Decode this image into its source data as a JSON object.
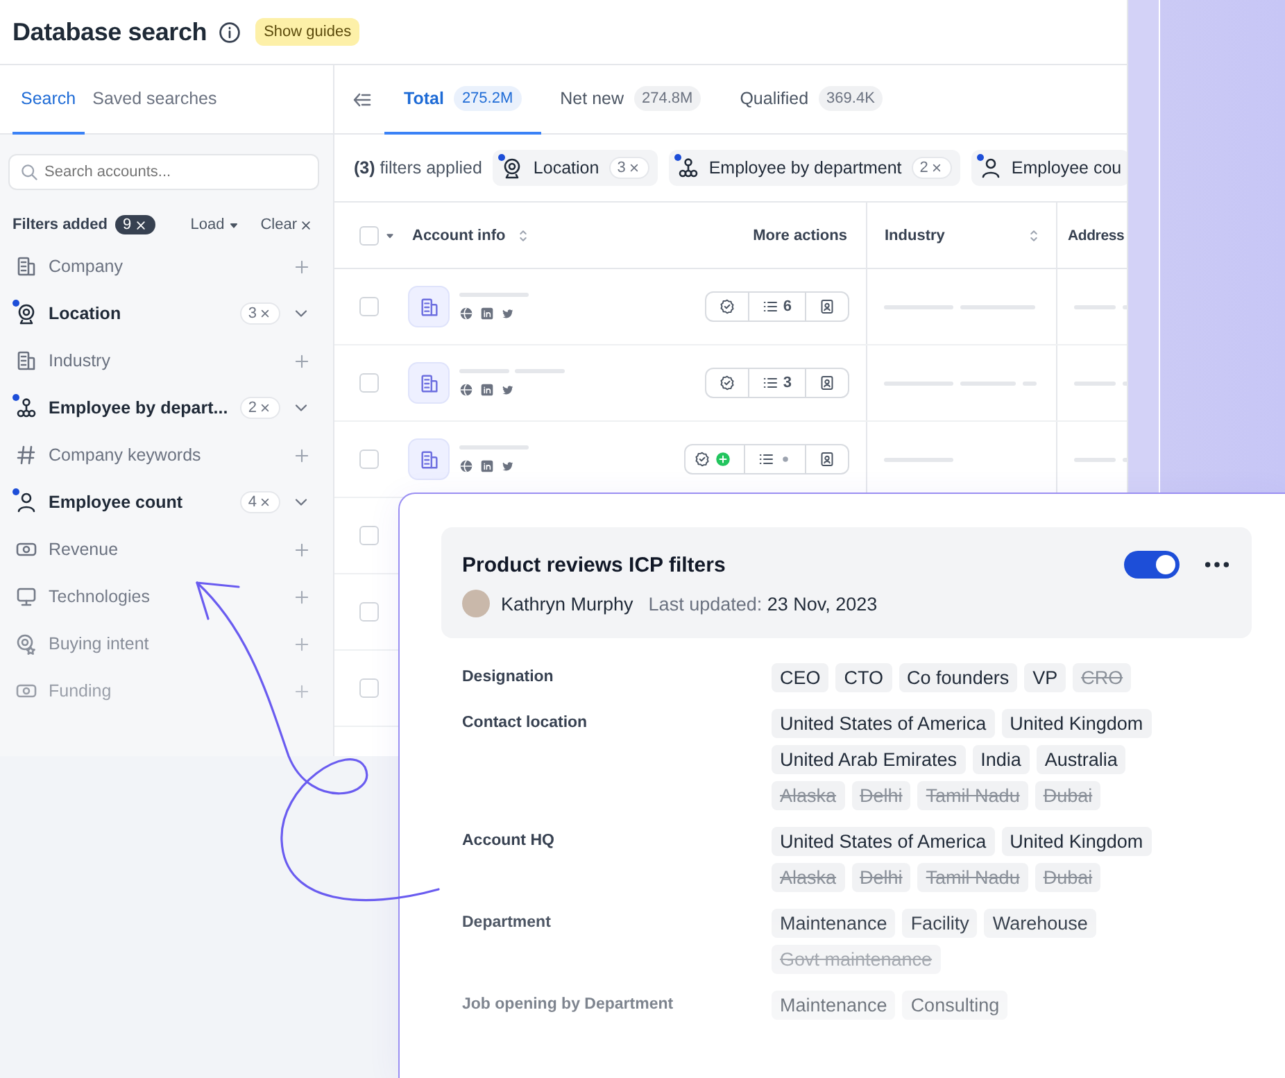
{
  "header": {
    "title": "Database search",
    "guides_button": "Show guides"
  },
  "sidebar": {
    "tabs": [
      {
        "label": "Search",
        "selected": true
      },
      {
        "label": "Saved searches",
        "selected": false
      }
    ],
    "search": {
      "placeholder": "Search accounts..."
    },
    "filters_added": {
      "label": "Filters added",
      "count": "9"
    },
    "load": "Load",
    "clear": "Clear",
    "filters": [
      {
        "label": "Company",
        "kind": "building",
        "active": false
      },
      {
        "label": "Location",
        "kind": "location",
        "active": true,
        "count": "3"
      },
      {
        "label": "Industry",
        "kind": "building",
        "active": false
      },
      {
        "label": "Employee by depart...",
        "kind": "department",
        "active": true,
        "count": "2"
      },
      {
        "label": "Company keywords",
        "kind": "hash",
        "active": false
      },
      {
        "label": "Employee count",
        "kind": "person",
        "active": true,
        "count": "4"
      },
      {
        "label": "Revenue",
        "kind": "money",
        "active": false
      },
      {
        "label": "Technologies",
        "kind": "monitor",
        "active": false
      },
      {
        "label": "Buying intent",
        "kind": "intent",
        "active": false
      },
      {
        "label": "Funding",
        "kind": "money",
        "active": false
      }
    ]
  },
  "main": {
    "tabs": [
      {
        "label": "Total",
        "count": "275.2M",
        "selected": true
      },
      {
        "label": "Net new",
        "count": "274.8M",
        "selected": false
      },
      {
        "label": "Qualified",
        "count": "369.4K",
        "selected": false
      }
    ],
    "filters_applied": {
      "count": "(3)",
      "label": "filters applied"
    },
    "chips": [
      {
        "label": "Location",
        "kind": "location",
        "count": "3"
      },
      {
        "label": "Employee by department",
        "kind": "department",
        "count": "2"
      },
      {
        "label": "Employee cou",
        "kind": "person"
      }
    ],
    "table": {
      "columns": [
        "Account info",
        "More actions",
        "Industry",
        "Address"
      ],
      "select_all_checked": false,
      "rows": [
        {
          "kind": "account",
          "checked": false,
          "list_count": "6",
          "added": false
        },
        {
          "kind": "account",
          "checked": false,
          "list_count": "3",
          "added": false
        },
        {
          "kind": "account",
          "checked": false,
          "added": true
        },
        {
          "kind": "covered",
          "checked": false
        },
        {
          "kind": "covered",
          "checked": false
        },
        {
          "kind": "covered",
          "checked": false
        }
      ]
    }
  },
  "card": {
    "title": "Product reviews ICP filters",
    "enabled": true,
    "author": "Kathryn Murphy",
    "updated_label": "Last updated:",
    "updated_value": "23 Nov, 2023",
    "sections": [
      {
        "label": "Designation",
        "tags": [
          {
            "text": "CEO",
            "excluded": false
          },
          {
            "text": "CTO",
            "excluded": false
          },
          {
            "text": "Co founders",
            "excluded": false
          },
          {
            "text": "VP",
            "excluded": false
          },
          {
            "text": "CRO",
            "excluded": true
          }
        ]
      },
      {
        "label": "Contact location",
        "tags": [
          {
            "text": "United States of America",
            "excluded": false
          },
          {
            "text": "United Kingdom",
            "excluded": false
          },
          {
            "text": "United Arab Emirates",
            "excluded": false
          },
          {
            "text": "India",
            "excluded": false
          },
          {
            "text": "Australia",
            "excluded": false
          },
          {
            "text": "Alaska",
            "excluded": true
          },
          {
            "text": "Delhi",
            "excluded": true
          },
          {
            "text": "Tamil Nadu",
            "excluded": true
          },
          {
            "text": "Dubai",
            "excluded": true
          }
        ]
      },
      {
        "label": "Account HQ",
        "tags": [
          {
            "text": "United States of America",
            "excluded": false
          },
          {
            "text": "United Kingdom",
            "excluded": false
          },
          {
            "text": "Alaska",
            "excluded": true
          },
          {
            "text": "Delhi",
            "excluded": true
          },
          {
            "text": "Tamil Nadu",
            "excluded": true
          },
          {
            "text": "Dubai",
            "excluded": true
          }
        ]
      },
      {
        "label": "Department",
        "tags": [
          {
            "text": "Maintenance",
            "excluded": false
          },
          {
            "text": "Facility",
            "excluded": false
          },
          {
            "text": "Warehouse",
            "excluded": false
          },
          {
            "text": "Govt maintenance",
            "excluded": true
          }
        ]
      },
      {
        "label": "Job opening by Department",
        "tags": [
          {
            "text": "Maintenance",
            "excluded": false
          },
          {
            "text": "Consulting",
            "excluded": false
          }
        ]
      }
    ]
  }
}
